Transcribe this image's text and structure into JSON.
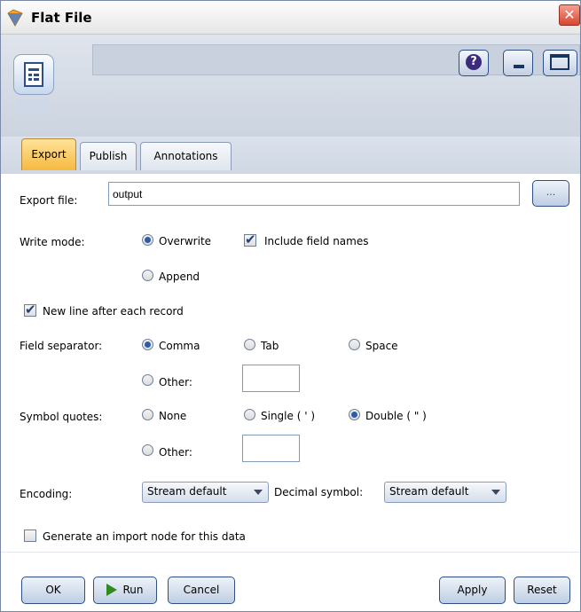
{
  "window": {
    "title": "Flat File",
    "close_glyph": "✕"
  },
  "header": {
    "help_glyph": "?"
  },
  "tabs": [
    {
      "label": "Export",
      "active": true
    },
    {
      "label": "Publish",
      "active": false
    },
    {
      "label": "Annotations",
      "active": false
    }
  ],
  "export_file": {
    "label": "Export file:",
    "value": "output",
    "browse_label": "..."
  },
  "write_mode": {
    "label": "Write mode:",
    "overwrite": "Overwrite",
    "append": "Append",
    "include_field_names": "Include field names",
    "selected": "Overwrite",
    "include_checked": true
  },
  "new_line": {
    "label": "New line after each record",
    "checked": true
  },
  "field_separator": {
    "label": "Field separator:",
    "comma": "Comma",
    "tab": "Tab",
    "space": "Space",
    "other": "Other:",
    "selected": "Comma",
    "other_value": ""
  },
  "symbol_quotes": {
    "label": "Symbol quotes:",
    "none": "None",
    "single": "Single ( ' )",
    "double": "Double ( \" )",
    "other": "Other:",
    "selected": "Double",
    "other_value": ""
  },
  "encoding": {
    "label": "Encoding:",
    "value": "Stream default"
  },
  "decimal_symbol": {
    "label": "Decimal symbol:",
    "value": "Stream default"
  },
  "generate_import": {
    "label": "Generate an import node for this data",
    "checked": false
  },
  "buttons": {
    "ok": "OK",
    "run": "Run",
    "cancel": "Cancel",
    "apply": "Apply",
    "reset": "Reset"
  },
  "colors": {
    "active_tab": "#f6b940",
    "header_bg": "#ccd4e0",
    "button_border": "#2d4f86"
  }
}
